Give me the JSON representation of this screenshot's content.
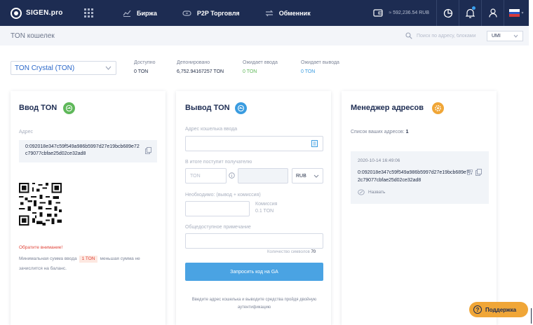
{
  "nav": {
    "logo": "SIGEN.pro",
    "links": [
      "Биржа",
      "P2P Торговля",
      "Обменник"
    ],
    "balance": "≈ 592,236.54 RUB"
  },
  "subheader": {
    "title": "TON кошелек",
    "search_placeholder": "Поиск по адресу, блоками",
    "currency": "UMI"
  },
  "coin_select": "TON Crystal (TON)",
  "stats": [
    {
      "label": "Доступно",
      "value": "0 TON"
    },
    {
      "label": "Депонировано",
      "value": "6,752.94167257 TON"
    },
    {
      "label": "Ожидает ввода",
      "value": "0 TON"
    },
    {
      "label": "Ожидает вывода",
      "value": "0 TON"
    }
  ],
  "deposit": {
    "title": "Ввод TON",
    "address_label": "Адрес",
    "address": "0:092018e347c59f549a986b5997d27e19bcb689e72c79077cbfae25d02ce32ad8",
    "warning_title": "Обратите внимание!",
    "warning_before": "Минимальная сумма ввода",
    "warning_amount": "1 TON",
    "warning_after": "меньшая сумма не зачислится на баланс."
  },
  "withdraw": {
    "title": "Вывод TON",
    "address_label": "Адрес кошелька ввода",
    "receive_label": "В итоге поступит получателю",
    "amount_placeholder": "TON",
    "currency": "RUB",
    "need_label": "Необходимо: (вывод + комиссия)",
    "commission_label": "Комиссия",
    "commission_value": "0.1 TON",
    "note_label": "Общедоступное примечание",
    "char_count_label": "Количество символов",
    "char_count": "70",
    "button": "Запросить код на GA",
    "hint": "Введите адрес кошелька и выводите средства пройдя двойную аутентификацию"
  },
  "manager": {
    "title": "Менеджер адресов",
    "list_label": "Список ваших адресов:",
    "list_count": "1",
    "item_date": "2020-10-14 16:49:06",
    "item_address": "0:092018e347c59f549a986b5997d27e19bcb689e72c79077cbfae25d02ce32ad8",
    "rename": "Назвать"
  },
  "support": "Поддержка",
  "colors": {
    "nav_bg": "#1d2c52",
    "accent_blue": "#4aa3e3",
    "green": "#5fb85a",
    "orange": "#f0a637",
    "warning_red": "#e0453a"
  },
  "icons": {
    "deposit": "deposit-arrow-icon",
    "withdraw": "withdraw-arrow-icon",
    "manager": "gear-icon"
  }
}
